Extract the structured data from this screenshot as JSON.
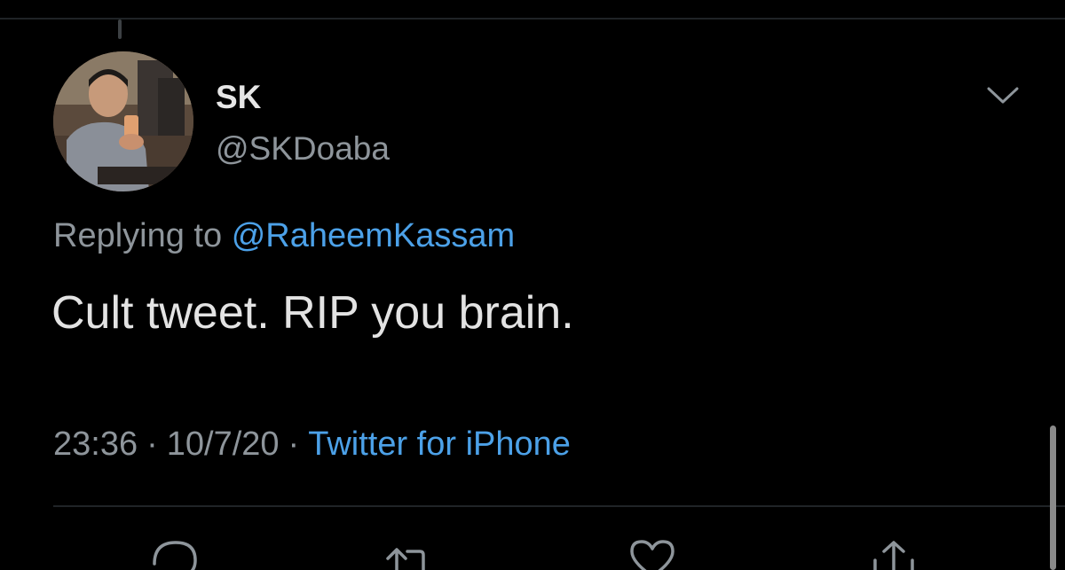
{
  "tweet": {
    "author": {
      "display_name": "SK",
      "handle": "@SKDoaba"
    },
    "reply": {
      "prefix": "Replying to",
      "mention": "@RaheemKassam"
    },
    "text": "Cult tweet. RIP you brain.",
    "meta": {
      "time": "23:36",
      "date": "10/7/20",
      "separator": "·",
      "source": "Twitter for iPhone"
    }
  },
  "icons": {
    "more_menu": "chevron-down-icon",
    "actions": [
      "reply-icon",
      "retweet-icon",
      "like-icon",
      "share-icon"
    ]
  },
  "colors": {
    "background": "#000000",
    "text_primary": "#e3e3e3",
    "text_secondary": "#8e959b",
    "link": "#4ca1e8",
    "divider": "#202427",
    "icon": "#8e959b"
  }
}
